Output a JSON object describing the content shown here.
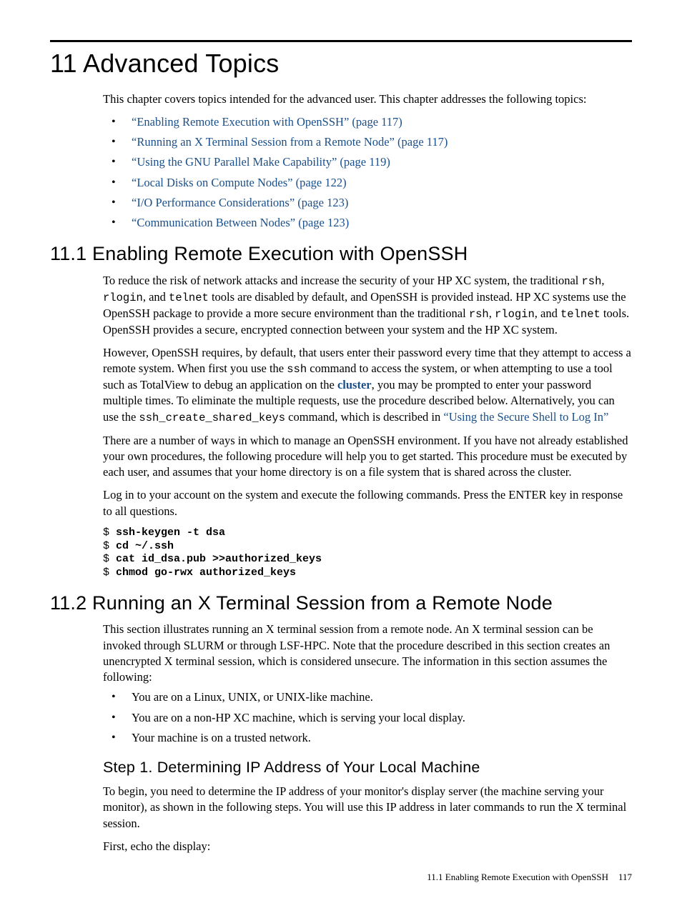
{
  "chapter": {
    "title": "11 Advanced Topics"
  },
  "intro": "This chapter covers topics intended for the advanced user. This chapter addresses the following topics:",
  "toc": [
    "“Enabling Remote Execution with OpenSSH” (page 117)",
    "“Running an X Terminal Session from a Remote Node” (page 117)",
    "“Using the GNU Parallel Make Capability” (page 119)",
    "“Local Disks on Compute Nodes” (page 122)",
    "“I/O Performance Considerations” (page 123)",
    "“Communication Between Nodes” (page 123)"
  ],
  "s111": {
    "title": "11.1 Enabling Remote Execution with OpenSSH",
    "p1a": "To reduce the risk of network attacks and increase the security of your HP XC system, the traditional ",
    "p1_rsh": "rsh",
    "p1b": ", ",
    "p1_rlogin": "rlogin",
    "p1c": ", and ",
    "p1_telnet": "telnet",
    "p1d": " tools are disabled by default, and OpenSSH is provided instead. HP XC systems use the OpenSSH package to provide a more secure environment than the traditional ",
    "p1_rsh2": "rsh",
    "p1e": ", ",
    "p1_rlogin2": "rlogin",
    "p1f": ", and ",
    "p1_telnet2": "telnet",
    "p1g": " tools. OpenSSH provides a secure, encrypted connection between your system and the HP XC system.",
    "p2a": "However, OpenSSH requires, by default, that users enter their password every time that they attempt to access a remote system. When first you use the ",
    "p2_ssh": "ssh",
    "p2b": " command to access the system, or when attempting to use a tool such as TotalView to debug an application on the ",
    "p2_cluster": "cluster",
    "p2c": ", you may be prompted to enter your password multiple times. To eliminate the multiple requests, use the procedure described below. Alternatively, you can use the ",
    "p2_cmd": "ssh_create_shared_keys",
    "p2d": " command, which is described in ",
    "p2_link": "“Using the Secure Shell to Log In”",
    "p3": "There are a number of ways in which to manage an OpenSSH environment. If you have not already established your own procedures, the following procedure will help you to get started. This procedure must be executed by each user, and assumes that your home directory is on a file system that is shared across the cluster.",
    "p4": "Log in to your account on the system and execute the following commands. Press the ENTER key in response to all questions.",
    "code": {
      "l1p": "$ ",
      "l1c": "ssh-keygen -t dsa",
      "l2p": "$ ",
      "l2c": "cd ~/.ssh",
      "l3p": "$ ",
      "l3c": "cat id_dsa.pub >>authorized_keys",
      "l4p": "$ ",
      "l4c": "chmod go-rwx authorized_keys"
    }
  },
  "s112": {
    "title": "11.2 Running an X Terminal Session from a Remote Node",
    "p1": "This section illustrates running an X terminal session from a remote node. An X terminal session can be invoked through SLURM or through LSF-HPC. Note that the procedure described in this section creates an unencrypted X terminal session, which is considered unsecure. The information in this section assumes the following:",
    "bullets": [
      "You are on a Linux, UNIX, or UNIX-like machine.",
      "You are on a non-HP XC machine, which is serving your local display.",
      "Your machine is on a trusted network."
    ],
    "step1": {
      "title": "Step 1. Determining IP Address of Your Local Machine",
      "p1": "To begin, you need to determine the IP address of your monitor's display server (the machine serving your monitor), as shown in the following steps. You will use this IP address in later commands to run the X terminal session.",
      "p2": "First, echo the display:"
    }
  },
  "footer": {
    "text": "11.1 Enabling Remote Execution with OpenSSH",
    "page": "117"
  }
}
